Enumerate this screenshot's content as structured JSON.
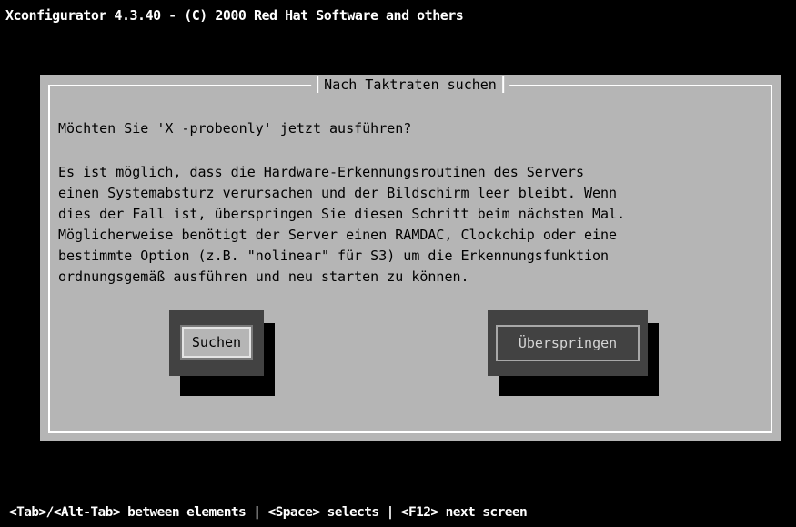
{
  "window": {
    "title": "Xconfigurator 4.3.40 - (C) 2000 Red Hat Software and others"
  },
  "dialog": {
    "title": "Nach Taktraten suchen",
    "question": "Möchten Sie 'X -probeonly' jetzt ausführen?",
    "body_lines": [
      "Es ist möglich, dass die Hardware-Erkennungsroutinen des Servers",
      "einen Systemabsturz verursachen und der Bildschirm leer bleibt. Wenn",
      "dies der Fall ist, überspringen Sie diesen Schritt beim nächsten Mal.",
      "Möglicherweise benötigt der Server einen RAMDAC, Clockchip oder eine",
      "bestimmte Option (z.B. \"nolinear\" für S3) um die Erkennungsfunktion",
      "ordnungsgemäß ausführen und neu starten zu können."
    ],
    "buttons": {
      "probe_label": "Suchen",
      "skip_label": "Überspringen",
      "focused": "probe"
    }
  },
  "status_bar": {
    "text": "<Tab>/<Alt-Tab> between elements   |  <Space> selects   |  <F12> next screen"
  },
  "colors": {
    "screen_background": "#000000",
    "dialog_background": "#b5b5b5",
    "frame": "#ffffff",
    "button_background": "#424242",
    "text": "#000000",
    "status_text": "#ffffff"
  }
}
